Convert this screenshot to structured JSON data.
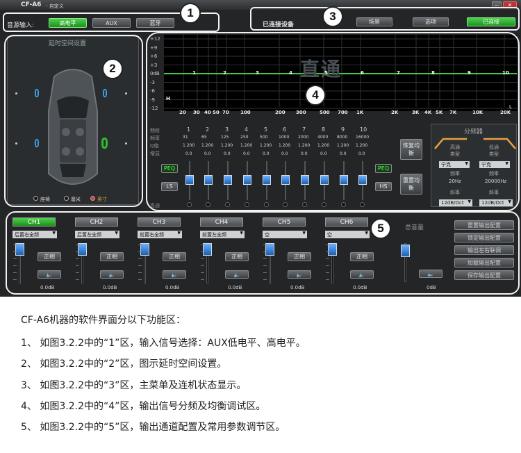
{
  "window": {
    "title": "CF-A6",
    "subtitle": "- 自定义",
    "min": "—",
    "close": "✕"
  },
  "input": {
    "label": "音源输入:",
    "options": [
      "高电平",
      "AUX",
      "蓝牙"
    ],
    "active": 0
  },
  "topbar": {
    "status": "已连接设备",
    "scene": "场景",
    "options": "选项",
    "connect": "已连接"
  },
  "delay": {
    "title": "延时空间设置",
    "radios": [
      "座椅",
      "厘米",
      "英寸"
    ]
  },
  "eq_graph": {
    "watermark": "直通",
    "y_labels": [
      "+12",
      "+9",
      "+6",
      "+3",
      "0dB",
      "-3",
      "-6",
      "-9",
      "-12"
    ],
    "x_labels": [
      "20",
      "30",
      "40",
      "50",
      "70",
      "100",
      "200",
      "300",
      "500",
      "700",
      "1K",
      "2K",
      "3K",
      "4K",
      "5K",
      "7K",
      "10K",
      "20K"
    ],
    "markers": [
      "1",
      "2",
      "3",
      "4",
      "5",
      "6",
      "7",
      "8",
      "9",
      "10"
    ],
    "h_label": "H",
    "l_label": "L"
  },
  "eq": {
    "row_labels": [
      "频段",
      "频率",
      "Q值",
      "增益"
    ],
    "numbers": [
      "1",
      "2",
      "3",
      "4",
      "5",
      "6",
      "7",
      "8",
      "9",
      "10"
    ],
    "freqs": [
      "31",
      "65",
      "125",
      "250",
      "500",
      "1000",
      "2000",
      "4000",
      "8000",
      "16000"
    ],
    "qs": [
      "1.200",
      "1.200",
      "1.200",
      "1.200",
      "1.200",
      "1.200",
      "1.200",
      "1.200",
      "1.200",
      "1.200"
    ],
    "gains": [
      "0.0",
      "0.0",
      "0.0",
      "0.0",
      "0.0",
      "0.0",
      "0.0",
      "0.0",
      "0.0",
      "0.0"
    ],
    "bottom": "直通",
    "peq": "PEQ",
    "ls": "LS",
    "hs": "HS",
    "restore": "恢复均衡",
    "reset": "重置均衡"
  },
  "crossover": {
    "title": "分频器",
    "hp": "高通",
    "lp": "低通",
    "type": "类型",
    "type_val": "宁克",
    "freq": "频率",
    "hp_freq": "20Hz",
    "lp_freq": "20000Hz",
    "slope": "斜率",
    "slope_val": "12dB/Oct"
  },
  "channels": [
    {
      "name": "CH1",
      "route": "后置右全频",
      "phase": "正相",
      "gain": "0.0dB"
    },
    {
      "name": "CH2",
      "route": "后置左全频",
      "phase": "正相",
      "gain": "0.0dB"
    },
    {
      "name": "CH3",
      "route": "前置右全频",
      "phase": "正相",
      "gain": "0.0dB"
    },
    {
      "name": "CH4",
      "route": "前置左全频",
      "phase": "正相",
      "gain": "0.0dB"
    },
    {
      "name": "CH5",
      "route": "空",
      "phase": "正相",
      "gain": "0.0dB"
    },
    {
      "name": "CH6",
      "route": "空",
      "phase": "正相",
      "gain": "0.0dB"
    }
  ],
  "master": {
    "label": "总音量",
    "gain": "0dB"
  },
  "side_buttons": [
    "重置输出配置",
    "锁定输出配置",
    "输出左右联调",
    "加载输出配置",
    "保存输出配置"
  ],
  "markers": [
    "1",
    "2",
    "3",
    "4",
    "5"
  ],
  "caption": {
    "intro": "CF-A6机器的软件界面分以下功能区：",
    "items": [
      "1、 如图3.2.2中的“1”区，输入信号选择：AUX低电平、高电平。",
      "2、 如图3.2.2中的“2”区，图示延时空间设置。",
      "3、 如图3.2.2中的“3”区，主菜单及连机状态显示。",
      "4、 如图3.2.2中的“4”区，输出信号分频及均衡调试区。",
      "5、 如图3.2.2中的“5”区，输出通道配置及常用参数调节区。"
    ]
  },
  "colors": {
    "accent_green": "#2fbf2f",
    "graph_line": "#3ecb3e",
    "bg": "#232527"
  }
}
